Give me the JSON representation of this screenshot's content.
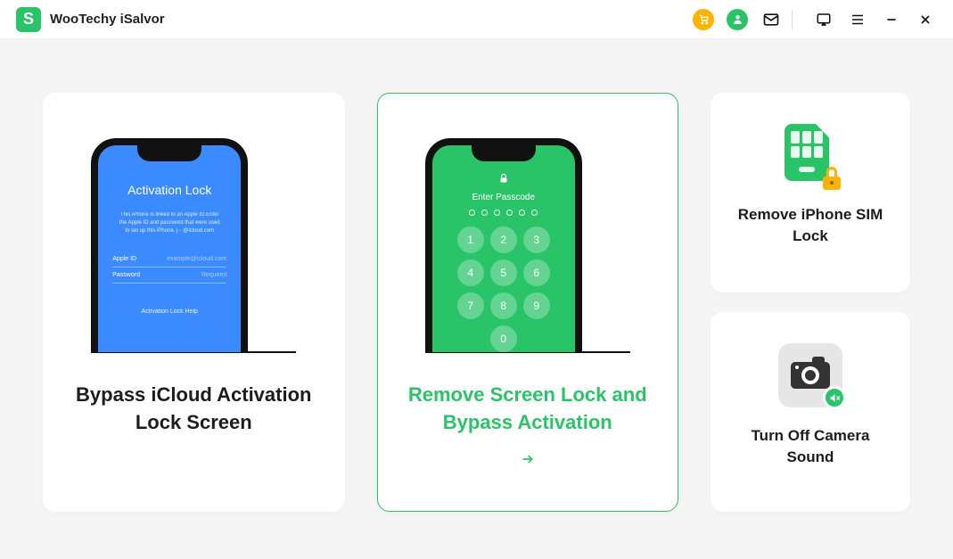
{
  "app": {
    "title": "WooTechy iSalvor"
  },
  "titlebar_icons": {
    "cart": "cart-icon",
    "account": "account-icon",
    "mail": "mail-icon",
    "feedback": "feedback-icon",
    "menu": "menu-icon",
    "minimize": "minimize-icon",
    "close": "close-icon"
  },
  "cards": {
    "bypass_icloud": {
      "title": "Bypass iCloud Activation Lock Screen",
      "phone": {
        "heading": "Activation Lock",
        "description": "This iPhone is linked to an Apple ID.Enter the Apple ID and password that were used to set up this iPhone. j···@icloud.com",
        "field_apple_label": "Apple ID",
        "field_apple_placeholder": "example@icloud.com",
        "field_password_label": "Password",
        "field_password_placeholder": "Required",
        "help": "Activation Lock Help"
      }
    },
    "remove_screen_lock": {
      "title": "Remove Screen Lock and Bypass Activation",
      "selected": true,
      "phone": {
        "heading": "Enter Passcode",
        "keys": [
          "1",
          "2",
          "3",
          "4",
          "5",
          "6",
          "7",
          "8",
          "9",
          "0"
        ]
      }
    },
    "remove_sim_lock": {
      "title": "Remove iPhone SIM Lock"
    },
    "turn_off_camera_sound": {
      "title": "Turn Off Camera Sound"
    }
  }
}
